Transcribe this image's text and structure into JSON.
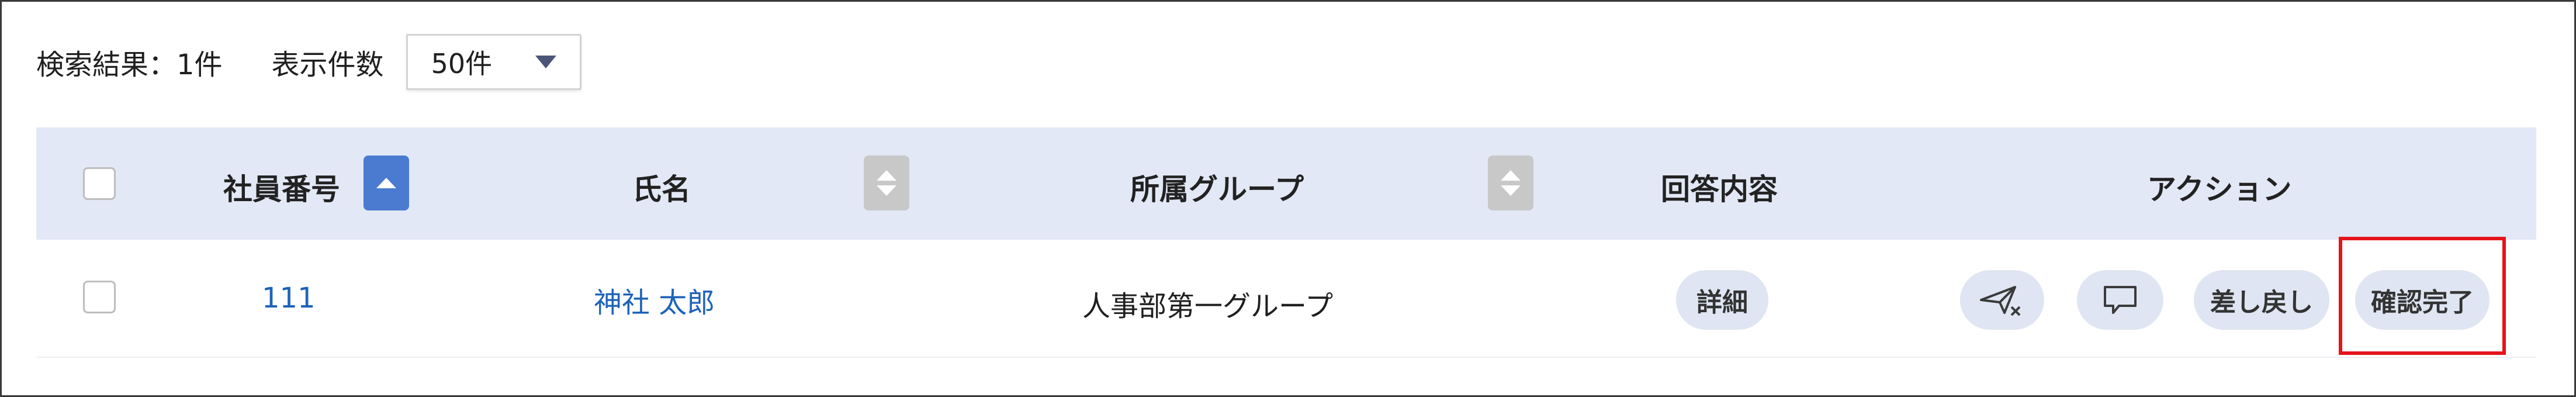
{
  "toolbar": {
    "result_text": "検索結果：1件",
    "per_page_label": "表示件数",
    "per_page_value": "50件"
  },
  "table": {
    "headers": {
      "employee_no": "社員番号",
      "name": "氏名",
      "group": "所属グループ",
      "answer": "回答内容",
      "actions": "アクション"
    },
    "rows": [
      {
        "employee_no": "111",
        "name": "神社 太郎",
        "group": "人事部第一グループ",
        "detail_label": "詳細",
        "actions": {
          "send_back_label": "差し戻し",
          "confirm_label": "確認完了"
        }
      }
    ]
  },
  "icons": {
    "send_cancel": "paper-plane-x-icon",
    "comment": "comment-icon",
    "sort_asc": "sort-ascending-icon",
    "sort_none": "sort-icon"
  },
  "colors": {
    "header_bg": "#e3e8f6",
    "link": "#1e63b8",
    "active_sort": "#4a7bd0",
    "highlight": "#e5141b"
  }
}
